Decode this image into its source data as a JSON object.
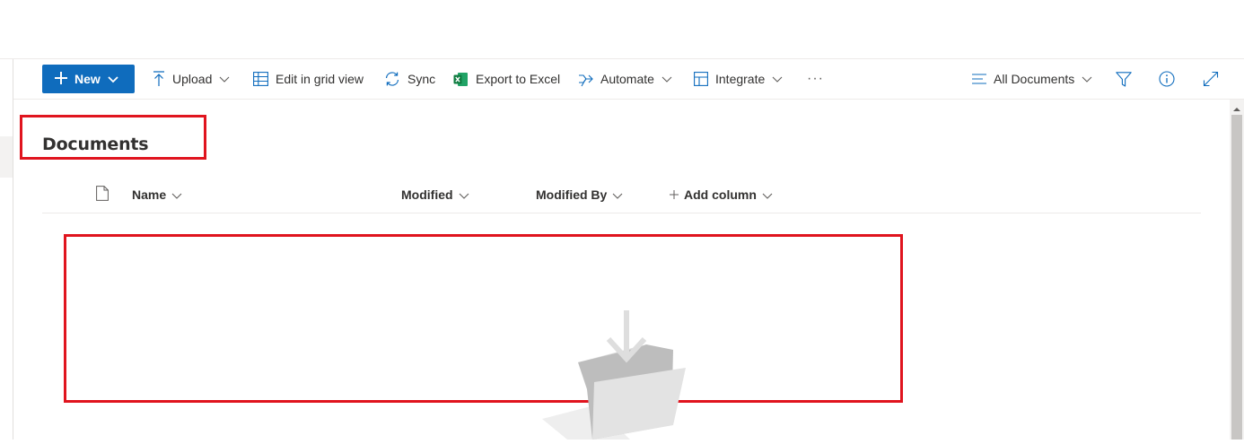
{
  "commandbar": {
    "new_label": "New",
    "upload_label": "Upload",
    "grid_label": "Edit in grid view",
    "sync_label": "Sync",
    "export_label": "Export to Excel",
    "automate_label": "Automate",
    "integrate_label": "Integrate",
    "more_label": "···",
    "view_label": "All Documents",
    "icons": {
      "new": "plus-icon",
      "upload": "upload-arrow-icon",
      "grid": "grid-table-icon",
      "sync": "sync-icon",
      "export": "excel-icon",
      "automate": "automate-flow-icon",
      "integrate": "integrate-icon",
      "view": "list-lines-icon",
      "filter": "filter-icon",
      "info": "info-icon",
      "expand": "expand-icon"
    }
  },
  "library": {
    "title": "Documents"
  },
  "columns": {
    "name": "Name",
    "modified": "Modified",
    "modified_by": "Modified By",
    "add_column": "Add column",
    "file_icon": "document-icon"
  },
  "colors": {
    "accent": "#0f6cbd",
    "annotation": "#e0141e",
    "excel_green": "#107c41"
  }
}
